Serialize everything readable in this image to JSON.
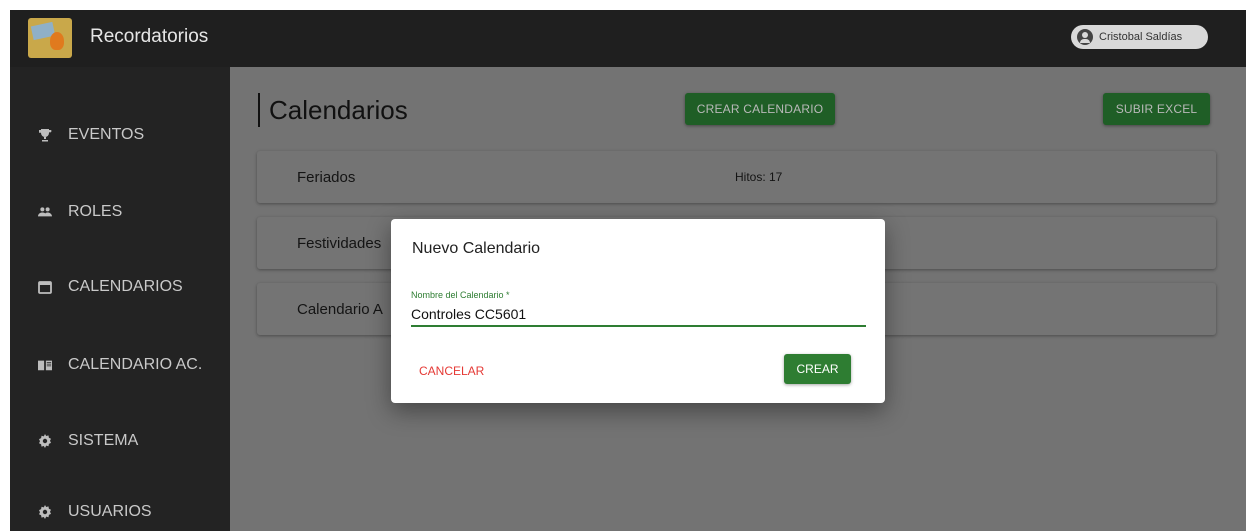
{
  "app": {
    "title": "Recordatorios"
  },
  "user": {
    "name": "Cristobal Saldías"
  },
  "sidebar": {
    "items": [
      {
        "label": "EVENTOS",
        "icon": "trophy-icon"
      },
      {
        "label": "ROLES",
        "icon": "people-icon"
      },
      {
        "label": "CALENDARIOS",
        "icon": "calendar-icon"
      },
      {
        "label": "CALENDARIO AC.",
        "icon": "book-icon"
      },
      {
        "label": "SISTEMA",
        "icon": "gear-icon"
      },
      {
        "label": "USUARIOS",
        "icon": "gear-icon"
      }
    ]
  },
  "main": {
    "title": "Calendarios",
    "create_button": "CREAR CALENDARIO",
    "upload_button": "SUBIR EXCEL",
    "calendars": [
      {
        "name": "Feriados",
        "hitos": "Hitos: 17"
      },
      {
        "name": "Festividades",
        "hitos": ""
      },
      {
        "name": "Calendario A",
        "hitos": ""
      }
    ]
  },
  "dialog": {
    "title": "Nuevo Calendario",
    "field_label": "Nombre del Calendario *",
    "field_value": "Controles CC5601",
    "cancel": "CANCELAR",
    "create": "CREAR"
  },
  "colors": {
    "accent_green": "#2e7d32",
    "cancel_red": "#e53935",
    "sidebar_bg": "#232323"
  }
}
